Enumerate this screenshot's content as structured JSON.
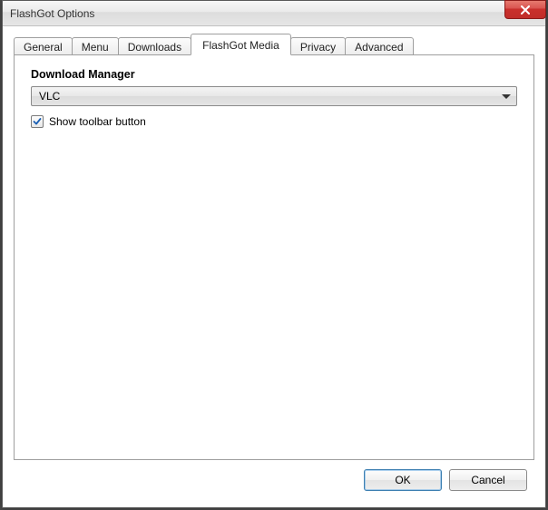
{
  "window": {
    "title": "FlashGot Options"
  },
  "tabs": {
    "t0": "General",
    "t1": "Menu",
    "t2": "Downloads",
    "t3": "FlashGot Media",
    "t4": "Privacy",
    "t5": "Advanced",
    "active_index": 3
  },
  "panel": {
    "section_label": "Download Manager",
    "dropdown_value": "VLC",
    "checkbox_checked": true,
    "checkbox_label": "Show toolbar button"
  },
  "buttons": {
    "ok": "OK",
    "cancel": "Cancel"
  }
}
